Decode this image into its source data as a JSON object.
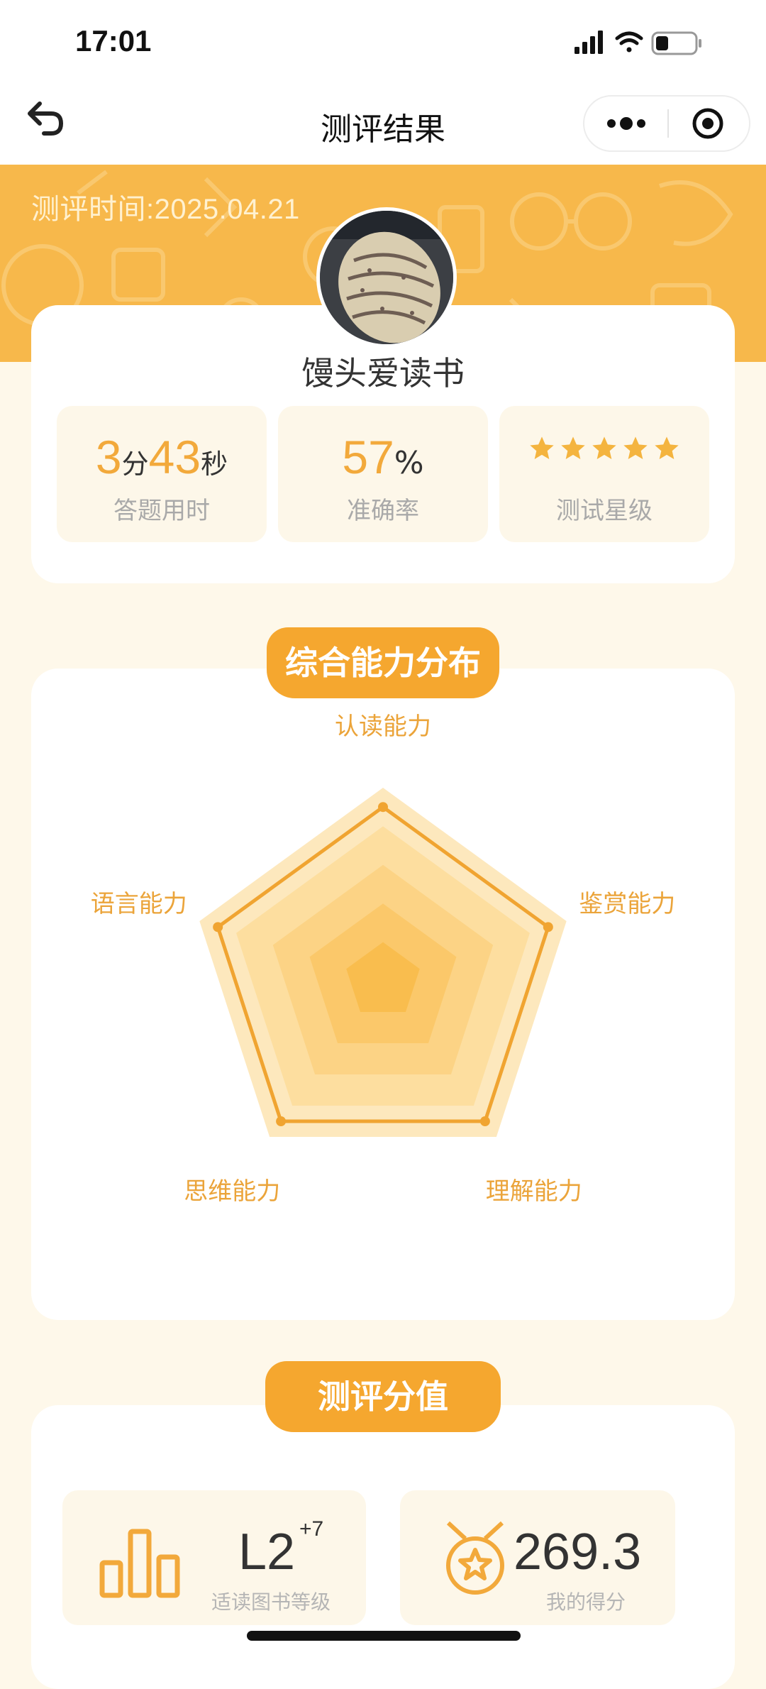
{
  "status_bar": {
    "time": "17:01"
  },
  "nav": {
    "title": "测评结果"
  },
  "header": {
    "test_time": "测评时间:2025.04.21"
  },
  "profile": {
    "username": "馒头爱读书"
  },
  "stats": {
    "duration": {
      "minutes": "3",
      "min_unit": "分",
      "seconds": "43",
      "sec_unit": "秒",
      "label": "答题用时"
    },
    "accuracy": {
      "value": "57",
      "unit": "%",
      "label": "准确率"
    },
    "stars": {
      "count": 5,
      "label": "测试星级"
    }
  },
  "ability_section": {
    "title": "综合能力分布",
    "chart_data": {
      "type": "radar",
      "axes": [
        "认读能力",
        "鉴赏能力",
        "理解能力",
        "思维能力",
        "语言能力"
      ],
      "values": [
        0.9,
        0.9,
        0.9,
        0.9,
        0.9
      ],
      "max": 1.0,
      "rings": 5
    }
  },
  "score_section": {
    "title": "测评分值",
    "level": {
      "value": "L2",
      "delta": "+7",
      "label": "适读图书等级"
    },
    "score": {
      "value": "269.3",
      "label": "我的得分"
    }
  },
  "colors": {
    "accent": "#F5A72F",
    "hero": "#F7B84B",
    "page_bg": "#FEF8EA"
  }
}
